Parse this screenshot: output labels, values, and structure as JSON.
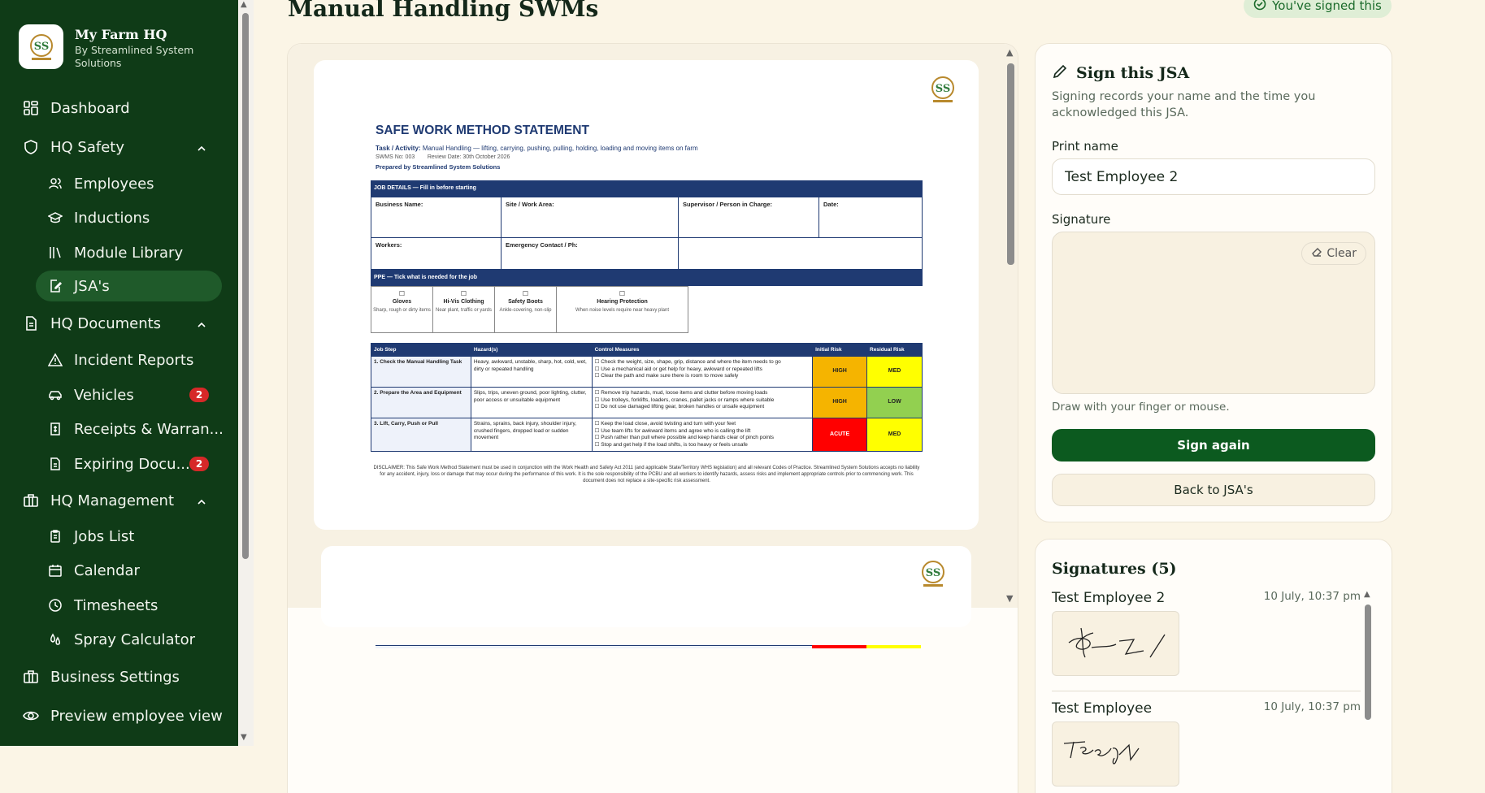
{
  "brand": {
    "title": "My Farm HQ",
    "subtitle": "By Streamlined System Solutions"
  },
  "nav": {
    "dashboard": "Dashboard",
    "hq_safety": "HQ Safety",
    "employees": "Employees",
    "inductions": "Inductions",
    "module_library": "Module Library",
    "jsas": "JSA's",
    "hq_documents": "HQ Documents",
    "incident_reports": "Incident Reports",
    "vehicles": "Vehicles",
    "vehicles_badge": "2",
    "receipts": "Receipts & Warran...",
    "expiring": "Expiring Docu...",
    "expiring_badge": "2",
    "hq_management": "HQ Management",
    "jobs_list": "Jobs List",
    "calendar": "Calendar",
    "timesheets": "Timesheets",
    "spray_calculator": "Spray Calculator",
    "business_settings": "Business Settings",
    "preview": "Preview employee view"
  },
  "header": {
    "title": "Manual Handling SWMs",
    "signed_status": "You've signed this"
  },
  "document": {
    "heading": "SAFE WORK METHOD STATEMENT",
    "task_label": "Task / Activity:",
    "task_value": "Manual Handling — lifting, carrying, pushing, pulling, holding, loading and moving items on farm",
    "swms_no": "SWMS No: 003",
    "review_date": "Review Date: 30th October 2026",
    "prepared_by": "Prepared by Streamlined System Solutions",
    "job_details_header": "JOB DETAILS — Fill in before starting",
    "business_name": "Business Name:",
    "site_area": "Site / Work Area:",
    "supervisor": "Supervisor / Person in Charge:",
    "date": "Date:",
    "workers": "Workers:",
    "emergency": "Emergency Contact / Ph:",
    "ppe_header": "PPE — Tick what is needed for the job",
    "ppe": [
      {
        "title": "Gloves",
        "desc": "Sharp, rough or dirty items"
      },
      {
        "title": "Hi-Vis Clothing",
        "desc": "Near plant, traffic or yards"
      },
      {
        "title": "Safety Boots",
        "desc": "Ankle-covering, non-slip"
      },
      {
        "title": "Hearing Protection",
        "desc": "When noise levels require near heavy plant"
      }
    ],
    "columns": [
      "Job Step",
      "Hazard(s)",
      "Control Measures",
      "Initial Risk",
      "Residual Risk"
    ],
    "rows": [
      {
        "step": "1. Check the Manual Handling Task",
        "hazard": "Heavy, awkward, unstable, sharp, hot, cold, wet, dirty or repeated handling",
        "controls": "☐ Check the weight, size, shape, grip, distance and where the item needs to go\n☐ Use a mechanical aid or get help for heavy, awkward or repeated lifts\n☐ Clear the path and make sure there is room to move safely",
        "initial": "HIGH",
        "residual": "MED"
      },
      {
        "step": "2. Prepare the Area and Equipment",
        "hazard": "Slips, trips, uneven ground, poor lighting, clutter, poor access or unsuitable equipment",
        "controls": "☐ Remove trip hazards, mud, loose items and clutter before moving loads\n☐ Use trolleys, forklifts, loaders, cranes, pallet jacks or ramps where suitable\n☐ Do not use damaged lifting gear, broken handles or unsafe equipment",
        "initial": "HIGH",
        "residual": "LOW"
      },
      {
        "step": "3. Lift, Carry, Push or Pull",
        "hazard": "Strains, sprains, back injury, shoulder injury, crushed fingers, dropped load or sudden movement",
        "controls": "☐ Keep the load close, avoid twisting and turn with your feet\n☐ Use team lifts for awkward items and agree who is calling the lift\n☐ Push rather than pull where possible and keep hands clear of pinch points\n☐ Stop and get help if the load shifts, is too heavy or feels unsafe",
        "initial": "ACUTE",
        "residual": "MED"
      }
    ],
    "disclaimer": "DISCLAIMER: This Safe Work Method Statement must be used in conjunction with the Work Health and Safety Act 2011 (and applicable State/Territory WHS legislation) and all relevant Codes of Practice. Streamlined System Solutions accepts no liability for any accident, injury, loss or damage that may occur during the performance of this work. It is the sole responsibility of the PCBU and all workers to identify hazards, assess risks and implement appropriate controls prior to commencing work. This document does not replace a site-specific risk assessment."
  },
  "sign": {
    "title": "Sign this JSA",
    "description": "Signing records your name and the time you acknowledged this JSA.",
    "print_name_label": "Print name",
    "print_name_value": "Test Employee 2",
    "signature_label": "Signature",
    "clear_label": "Clear",
    "hint": "Draw with your finger or mouse.",
    "sign_again": "Sign again",
    "back": "Back to JSA's"
  },
  "signatures": {
    "title": "Signatures (5)",
    "entries": [
      {
        "name": "Test Employee 2",
        "time": "10 July, 10:37 pm"
      },
      {
        "name": "Test Employee",
        "time": "10 July, 10:37 pm"
      }
    ]
  },
  "colors": {
    "sidebar": "#0f3b17",
    "active": "#1f5a2a",
    "primary_button": "#0c5a1f",
    "badge": "#d62828",
    "background": "#fbf5e6"
  }
}
